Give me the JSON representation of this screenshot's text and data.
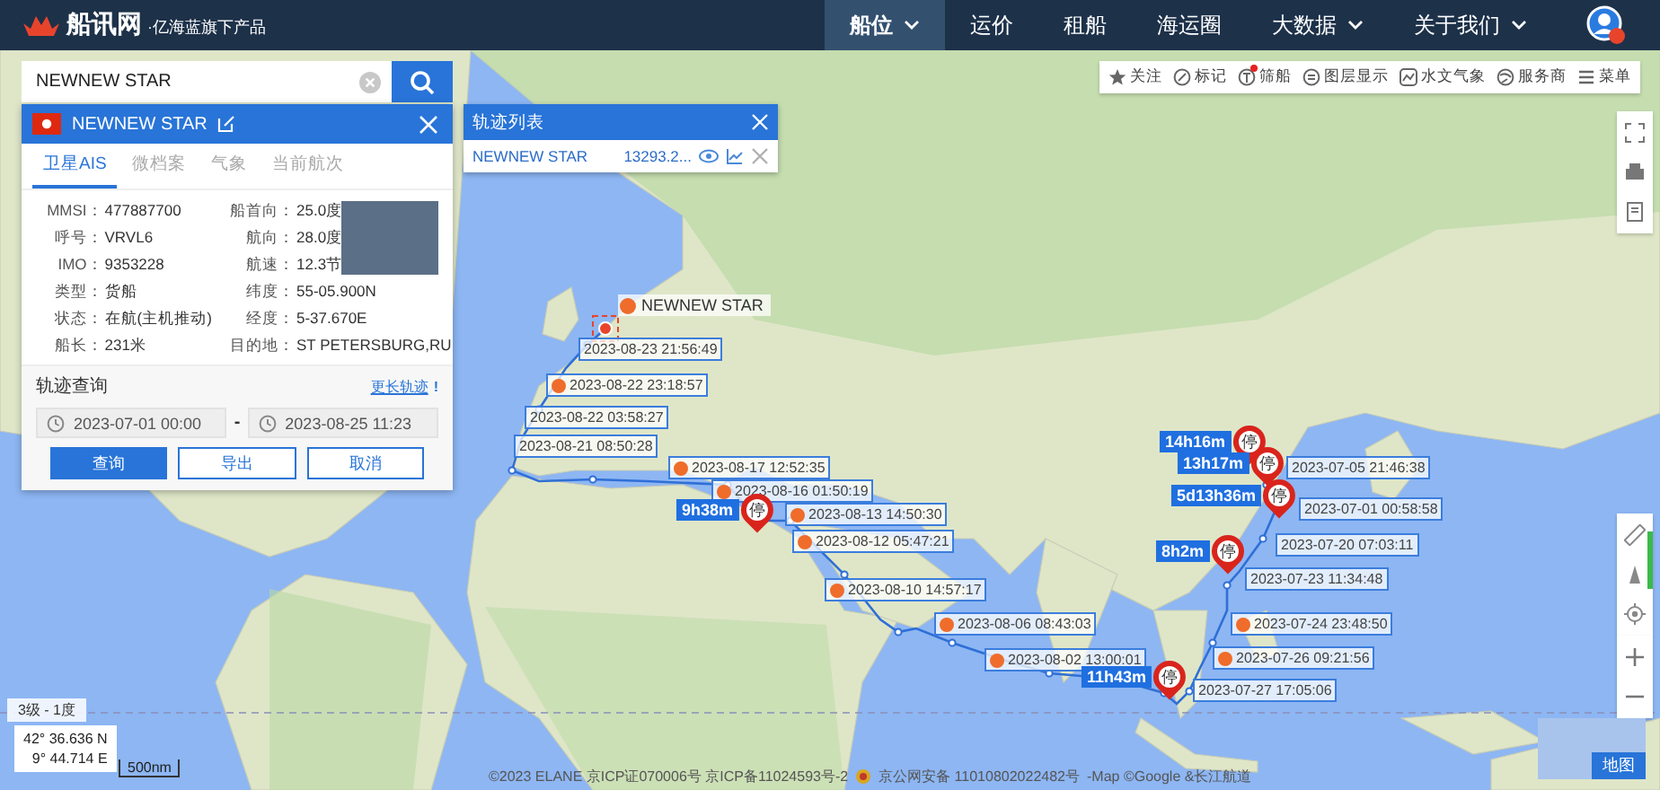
{
  "header": {
    "logo": "船讯网",
    "tagline": "·亿海蓝旗下产品",
    "nav": [
      {
        "label": "船位",
        "selected": true,
        "dropdown": true
      },
      {
        "label": "运价",
        "selected": false,
        "dropdown": false
      },
      {
        "label": "租船",
        "selected": false,
        "dropdown": false
      },
      {
        "label": "海运圈",
        "selected": false,
        "dropdown": false
      },
      {
        "label": "大数据",
        "selected": false,
        "dropdown": true
      },
      {
        "label": "关于我们",
        "selected": false,
        "dropdown": true
      }
    ]
  },
  "search": {
    "value": "NEWNEW STAR"
  },
  "toolbar": [
    {
      "label": "关注",
      "notify": false
    },
    {
      "label": "标记",
      "notify": false
    },
    {
      "label": "筛船",
      "notify": true
    },
    {
      "label": "图层显示",
      "notify": false
    },
    {
      "label": "水文气象",
      "notify": false
    },
    {
      "label": "服务商",
      "notify": false
    },
    {
      "label": "菜单",
      "notify": false
    }
  ],
  "ship_card": {
    "name": "NEWNEW STAR",
    "tabs": [
      {
        "label": "卫星AIS",
        "selected": true
      },
      {
        "label": "微档案",
        "selected": false
      },
      {
        "label": "气象",
        "selected": false
      },
      {
        "label": "当前航次",
        "selected": false
      }
    ],
    "fields_left": [
      {
        "label": "MMSI：",
        "value": "477887700"
      },
      {
        "label": "呼号：",
        "value": "VRVL6"
      },
      {
        "label": "IMO：",
        "value": "9353228"
      },
      {
        "label": "类型：",
        "value": "货船"
      },
      {
        "label": "状态：",
        "value": "在航(主机推动)"
      },
      {
        "label": "船长：",
        "value": "231米"
      }
    ],
    "fields_right": [
      {
        "label": "船首向：",
        "value": "25.0度"
      },
      {
        "label": "航向：",
        "value": "28.0度"
      },
      {
        "label": "航速：",
        "value": "12.3节"
      },
      {
        "label": "纬度：",
        "value": "55-05.900N"
      },
      {
        "label": "经度：",
        "value": "5-37.670E"
      },
      {
        "label": "目的地：",
        "value": "ST PETERSBURG,RU"
      }
    ],
    "track_query": {
      "title": "轨迹查询",
      "link": "更长轨迹",
      "info": "!",
      "start": "2023-07-01 00:00",
      "separator": "-",
      "end": "2023-08-25 11:23",
      "buttons": [
        {
          "label": "查询",
          "primary": true
        },
        {
          "label": "导出",
          "primary": false
        },
        {
          "label": "取消",
          "primary": false
        }
      ]
    }
  },
  "track_list": {
    "title": "轨迹列表",
    "rows": [
      {
        "name": "NEWNEW STAR",
        "distance": "13293.2..."
      }
    ]
  },
  "map": {
    "ship_label": "NEWNEW STAR",
    "time_labels": [
      {
        "text": "2023-08-23 21:56:49",
        "event": false
      },
      {
        "text": "2023-08-22 23:18:57",
        "event": true
      },
      {
        "text": "2023-08-22 03:58:27",
        "event": false
      },
      {
        "text": "2023-08-21 08:50:28",
        "event": false
      },
      {
        "text": "2023-08-17 12:52:35",
        "event": true
      },
      {
        "text": "2023-08-16 01:50:19",
        "event": true
      },
      {
        "text": "2023-08-13 14:50:30",
        "event": true
      },
      {
        "text": "2023-08-12 05:47:21",
        "event": true
      },
      {
        "text": "2023-08-10 14:57:17",
        "event": true
      },
      {
        "text": "2023-08-06 08:43:03",
        "event": true
      },
      {
        "text": "2023-08-02 13:00:01",
        "event": true
      },
      {
        "text": "2023-07-05 21:46:38",
        "event": false
      },
      {
        "text": "2023-07-01 00:58:58",
        "event": false
      },
      {
        "text": "2023-07-20 07:03:11",
        "event": false
      },
      {
        "text": "2023-07-23 11:34:48",
        "event": false
      },
      {
        "text": "2023-07-24 23:48:50",
        "event": true
      },
      {
        "text": "2023-07-26 09:21:56",
        "event": true
      },
      {
        "text": "2023-07-27 17:05:06",
        "event": false
      }
    ],
    "stops": [
      {
        "duration": "9h38m",
        "pin": "停"
      },
      {
        "duration": "14h16m",
        "pin": "停"
      },
      {
        "duration": "13h17m",
        "pin": "停"
      },
      {
        "duration": "5d13h36m",
        "pin": "停"
      },
      {
        "duration": "8h2m",
        "pin": "停"
      },
      {
        "duration": "11h43m",
        "pin": "停"
      }
    ],
    "zoom_level": "3级 - 1度",
    "lat": "42° 36.636 N",
    "lon": "9° 44.714 E",
    "scale": "500nm",
    "map_type": "地图",
    "attribution": "©2023 ELANE 京ICP证070006号 京ICP备11024593号-2",
    "police": "京公网安备 11010802022482号",
    "map_credit": "-Map ©Google &长江航道"
  }
}
